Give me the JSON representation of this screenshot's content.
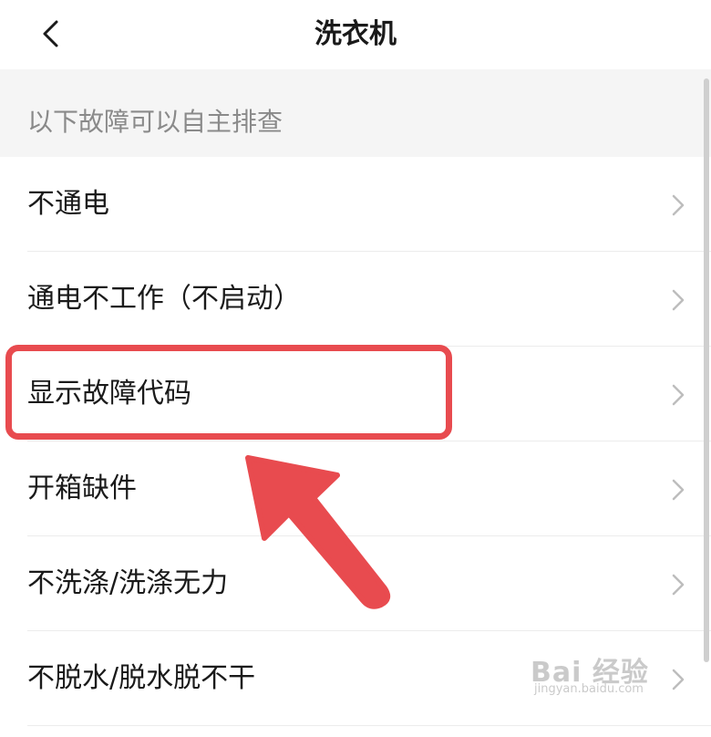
{
  "header": {
    "title": "洗衣机",
    "back_icon": "chevron-left-icon"
  },
  "section": {
    "header_text": "以下故障可以自主排查"
  },
  "list": {
    "items": [
      {
        "label": "不通电"
      },
      {
        "label": "通电不工作（不启动）"
      },
      {
        "label": "显示故障代码"
      },
      {
        "label": "开箱缺件"
      },
      {
        "label": "不洗涤/洗涤无力"
      },
      {
        "label": "不脱水/脱水脱不干"
      }
    ],
    "item_icon": "chevron-right-icon"
  },
  "annotation": {
    "highlighted_item": "显示故障代码",
    "color": "#e84b4f"
  },
  "watermark": {
    "brand": "Bai  经验",
    "url": "jingyan.baidu.com"
  },
  "colors": {
    "title": "#1a1a1a",
    "section_background": "#f5f5f5",
    "section_text": "#8a8a8a",
    "chevron": "#bdbdbd"
  }
}
